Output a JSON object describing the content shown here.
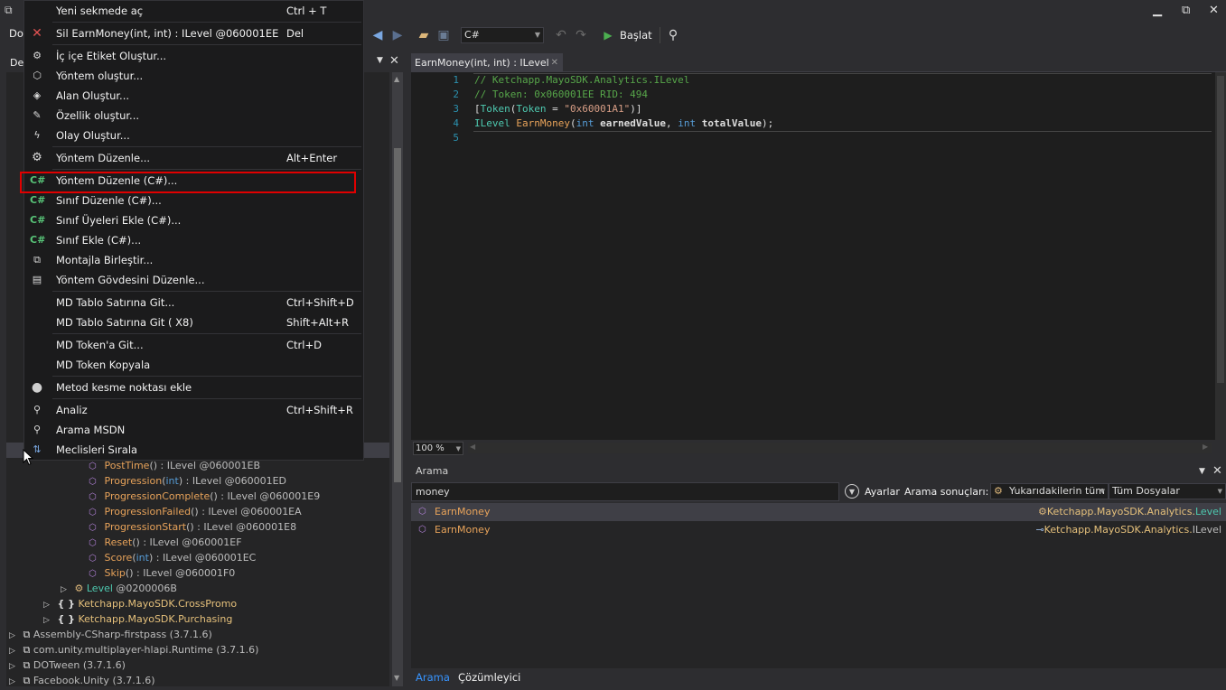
{
  "toolbar": {
    "menu_partial": "Do",
    "language": "C#",
    "start_label": "Başlat"
  },
  "left_pane": {
    "tab_partial": "De",
    "tree": [
      {
        "name": "PostTime",
        "params": "()",
        "rest": " : ILevel @060001EB"
      },
      {
        "name": "Progression",
        "param_type": "int",
        "rest": " : ILevel @060001ED"
      },
      {
        "name": "ProgressionComplete",
        "params": "()",
        "rest": " : ILevel @060001E9"
      },
      {
        "name": "ProgressionFailed",
        "params": "()",
        "rest": " : ILevel @060001EA"
      },
      {
        "name": "ProgressionStart",
        "params": "()",
        "rest": " : ILevel @060001E8"
      },
      {
        "name": "Reset",
        "params": "()",
        "rest": " : ILevel @060001EF"
      },
      {
        "name": "Score",
        "param_type": "int",
        "rest": " : ILevel @060001EC"
      },
      {
        "name": "Skip",
        "params": "()",
        "rest": " : ILevel @060001F0"
      }
    ],
    "level_node": {
      "name": "Level",
      "token": " @0200006B"
    },
    "namespaces": [
      "Ketchapp.MayoSDK.CrossPromo",
      "Ketchapp.MayoSDK.Purchasing"
    ],
    "assemblies": [
      "Assembly-CSharp-firstpass (3.7.1.6)",
      "com.unity.multiplayer-hlapi.Runtime (3.7.1.6)",
      "DOTween (3.7.1.6)",
      "Facebook.Unity (3.7.1.6)"
    ]
  },
  "editor": {
    "tab_title": "EarnMoney(int, int) : ILevel",
    "lines": [
      {
        "n": "1",
        "text": "// Ketchapp.MayoSDK.Analytics.ILevel"
      },
      {
        "n": "2",
        "text": "// Token: 0x060001EE RID: 494"
      },
      {
        "n": "3",
        "attr": "Token",
        "attr_param": "Token",
        "attr_value": "\"0x60001A1\""
      },
      {
        "n": "4",
        "type": "ILevel",
        "method": "EarnMoney",
        "kw": "int",
        "p1": "earnedValue",
        "p2": "totalValue"
      },
      {
        "n": "5",
        "text": ""
      }
    ],
    "zoom": "100 %"
  },
  "search": {
    "title": "Arama",
    "query": "money",
    "settings_label": "Ayarlar",
    "results_label": "Arama sonuçları:",
    "scope_dropdown": "Yukarıdakilerin tüm",
    "files_dropdown": "Tüm Dosyalar",
    "results": [
      {
        "name": "EarnMoney",
        "location_prefix": "Ketchapp.MayoSDK.Analytics.",
        "location_type": "Level"
      },
      {
        "name": "EarnMoney",
        "location_prefix": "Ketchapp.MayoSDK.Analytics.",
        "location_type": "ILevel"
      }
    ],
    "footer_tabs": [
      "Arama",
      "Çözümleyici"
    ]
  },
  "context_menu": {
    "items": [
      {
        "label": "Yeni sekmede aç",
        "shortcut": "Ctrl + T"
      },
      {
        "label": "Sil EarnMoney(int, int) : ILevel @060001EE",
        "shortcut": "Del"
      },
      {
        "label": "İç içe Etiket Oluştur...",
        "shortcut": ""
      },
      {
        "label": "Yöntem oluştur...",
        "shortcut": ""
      },
      {
        "label": "Alan Oluştur...",
        "shortcut": ""
      },
      {
        "label": "Özellik oluştur...",
        "shortcut": ""
      },
      {
        "label": "Olay Oluştur...",
        "shortcut": ""
      },
      {
        "label": "Yöntem Düzenle...",
        "shortcut": "Alt+Enter"
      },
      {
        "label": "Yöntem Düzenle (C#)...",
        "shortcut": ""
      },
      {
        "label": "Sınıf Düzenle (C#)...",
        "shortcut": ""
      },
      {
        "label": "Sınıf Üyeleri Ekle (C#)...",
        "shortcut": ""
      },
      {
        "label": "Sınıf Ekle (C#)...",
        "shortcut": ""
      },
      {
        "label": "Montajla Birleştir...",
        "shortcut": ""
      },
      {
        "label": "Yöntem Gövdesini Düzenle...",
        "shortcut": ""
      },
      {
        "label": "MD Tablo Satırına Git...",
        "shortcut": "Ctrl+Shift+D"
      },
      {
        "label": "MD Tablo Satırına Git ( X8)",
        "shortcut": "Shift+Alt+R"
      },
      {
        "label": "MD Token'a Git...",
        "shortcut": "Ctrl+D"
      },
      {
        "label": "MD Token Kopyala",
        "shortcut": ""
      },
      {
        "label": "Metod kesme noktası ekle",
        "shortcut": ""
      },
      {
        "label": "Analiz",
        "shortcut": "Ctrl+Shift+R"
      },
      {
        "label": "Arama MSDN",
        "shortcut": ""
      },
      {
        "label": "Meclisleri Sırala",
        "shortcut": ""
      }
    ],
    "csharp_badge": "C#"
  },
  "colors": {
    "background": "#2d2d30",
    "editor_bg": "#1e1e1e",
    "menu_bg": "#1b1b1c",
    "highlight_border": "#e00000",
    "method_name": "#e8a35a",
    "namespace": "#e5c07b",
    "comment": "#57a64a",
    "keyword": "#569cd6"
  }
}
